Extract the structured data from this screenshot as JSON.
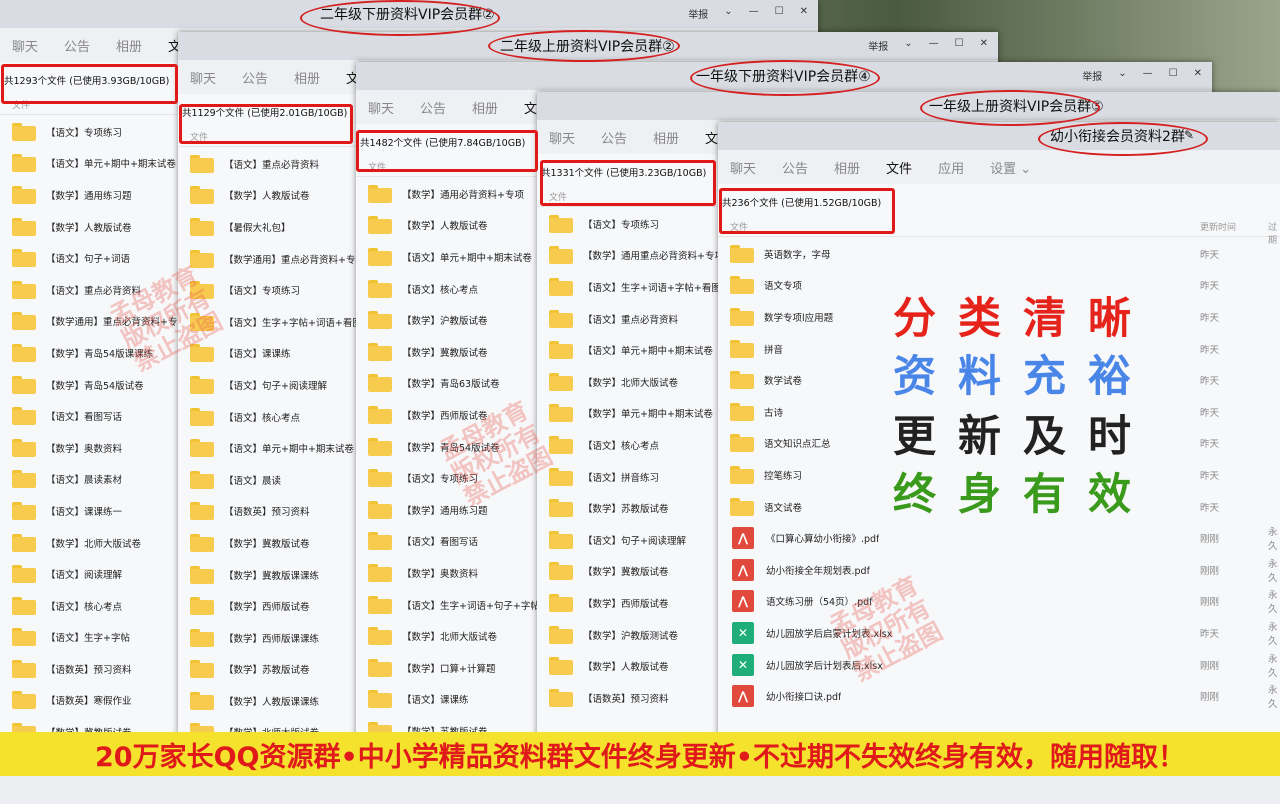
{
  "tabs": {
    "chat": "聊天",
    "notice": "公告",
    "album": "相册",
    "files": "文件",
    "apps": "应用",
    "settings": "设置"
  },
  "header": {
    "file_col": "文件",
    "updated_col": "更新时间",
    "expire_col": "过期"
  },
  "controls": {
    "report": "举报"
  },
  "windows": {
    "w1": {
      "title": "二年级下册资料VIP会员群②",
      "stats": "共1293个文件 (已使用3.93GB/10GB)",
      "files": [
        "【语文】专项练习",
        "【语文】单元+期中+期末试卷",
        "【数学】通用练习题",
        "【数学】人教版试卷",
        "【语文】句子+词语",
        "【语文】重点必背资料",
        "【数学通用】重点必背资料+专项",
        "【数学】青岛54版课课练",
        "【数学】青岛54版试卷",
        "【语文】看图写话",
        "【数学】奥数资料",
        "【语文】晨读素材",
        "【语文】课课练一",
        "【数学】北师大版试卷",
        "【语文】阅读理解",
        "【语文】核心考点",
        "【语文】生字+字帖",
        "【语数英】预习资料",
        "【语数英】寒假作业",
        "【数学】冀教版试卷"
      ]
    },
    "w2": {
      "title": "二年级上册资料VIP会员群②",
      "stats": "共1129个文件 (已使用2.01GB/10GB)",
      "files": [
        "【语文】重点必背资料",
        "【数学】人教版试卷",
        "【暑假大礼包】",
        "【数学通用】重点必背资料+专项",
        "【语文】专项练习",
        "【语文】生字+字帖+词语+看图",
        "【语文】课课练",
        "【语文】句子+阅读理解",
        "【语文】核心考点",
        "【语文】单元+期中+期末试卷",
        "【语文】晨读",
        "【语数英】预习资料",
        "【数学】冀教版试卷",
        "【数学】冀教版课课练",
        "【数学】西师版试卷",
        "【数学】西师版课课练",
        "【数学】苏教版试卷",
        "【数学】人教版课课练",
        "【数学】北师大版试卷"
      ]
    },
    "w3": {
      "title": "一年级下册资料VIP会员群④",
      "stats": "共1482个文件 (已使用7.84GB/10GB)",
      "files": [
        "【数学】通用必背资料+专项",
        "【数学】人教版试卷",
        "【语文】单元+期中+期末试卷",
        "【语文】核心考点",
        "【数学】沪教版试卷",
        "【数学】冀教版试卷",
        "【数学】青岛63版试卷",
        "【数学】西师版试卷",
        "【数学】青岛54版试卷",
        "【语文】专项练习",
        "【数学】通用练习题",
        "【语文】看图写话",
        "【数学】奥数资料",
        "【语文】生字+词语+句子+字帖",
        "【数学】北师大版试卷",
        "【数学】口算+计算题",
        "【语文】课课练",
        "【数学】苏教版试卷"
      ]
    },
    "w4": {
      "title": "一年级上册资料VIP会员群⑤",
      "stats": "共1331个文件 (已使用3.23GB/10GB)",
      "files": [
        "【语文】专项练习",
        "【数学】通用重点必背资料+专项",
        "【语文】生字+词语+字帖+看图",
        "【语文】重点必背资料",
        "【语文】单元+期中+期末试卷",
        "【数学】北师大版试卷",
        "【数学】单元+期中+期末试卷",
        "【语文】核心考点",
        "【语文】拼音练习",
        "【数学】苏教版试卷",
        "【语文】句子+阅读理解",
        "【数学】冀教版试卷",
        "【数学】西师版试卷",
        "【数学】沪教版测试卷",
        "【数学】人教版试卷",
        "【语数英】预习资料"
      ]
    },
    "w5": {
      "title": "幼小衔接会员资料2群",
      "stats": "共236个文件 (已使用1.52GB/10GB)",
      "files": [
        {
          "name": "英语数字，字母",
          "time": "昨天",
          "type": "folder"
        },
        {
          "name": "语文专项",
          "time": "昨天",
          "type": "folder"
        },
        {
          "name": "数学专项l应用题",
          "time": "昨天",
          "type": "folder"
        },
        {
          "name": "拼音",
          "time": "昨天",
          "type": "folder"
        },
        {
          "name": "数学试卷",
          "time": "昨天",
          "type": "folder"
        },
        {
          "name": "古诗",
          "time": "昨天",
          "type": "folder"
        },
        {
          "name": "语文知识点汇总",
          "time": "昨天",
          "type": "folder"
        },
        {
          "name": "控笔练习",
          "time": "昨天",
          "type": "folder"
        },
        {
          "name": "语文试卷",
          "time": "昨天",
          "type": "folder"
        },
        {
          "name": "《口算心算幼小衔接》.pdf",
          "time": "刚刚",
          "type": "pdf",
          "extra": "永久"
        },
        {
          "name": "幼小衔接全年规划表.pdf",
          "time": "刚刚",
          "type": "pdf",
          "extra": "永久"
        },
        {
          "name": "语文练习册（54页）.pdf",
          "time": "刚刚",
          "type": "pdf",
          "extra": "永久"
        },
        {
          "name": "幼儿园放学后启蒙计划表.xlsx",
          "time": "昨天",
          "type": "xls",
          "extra": "永久"
        },
        {
          "name": "幼儿园放学后计划表后.xlsx",
          "time": "刚刚",
          "type": "xls",
          "extra": "永久"
        },
        {
          "name": "幼小衔接口诀.pdf",
          "time": "刚刚",
          "type": "pdf",
          "extra": "永久"
        }
      ]
    }
  },
  "slogans": [
    {
      "text": "分类清晰",
      "color": "#e5231b"
    },
    {
      "text": "资料充裕",
      "color": "#4a86e8"
    },
    {
      "text": "更新及时",
      "color": "#222222"
    },
    {
      "text": "终身有效",
      "color": "#3a9a1c"
    }
  ],
  "watermark": {
    "l1": "孟母教育",
    "l2": "版权所有",
    "l3": "禁止盗图"
  },
  "banner": "20万家长QQ资源群•中小学精品资料群文件终身更新•不过期不失效终身有效，随用随取！"
}
